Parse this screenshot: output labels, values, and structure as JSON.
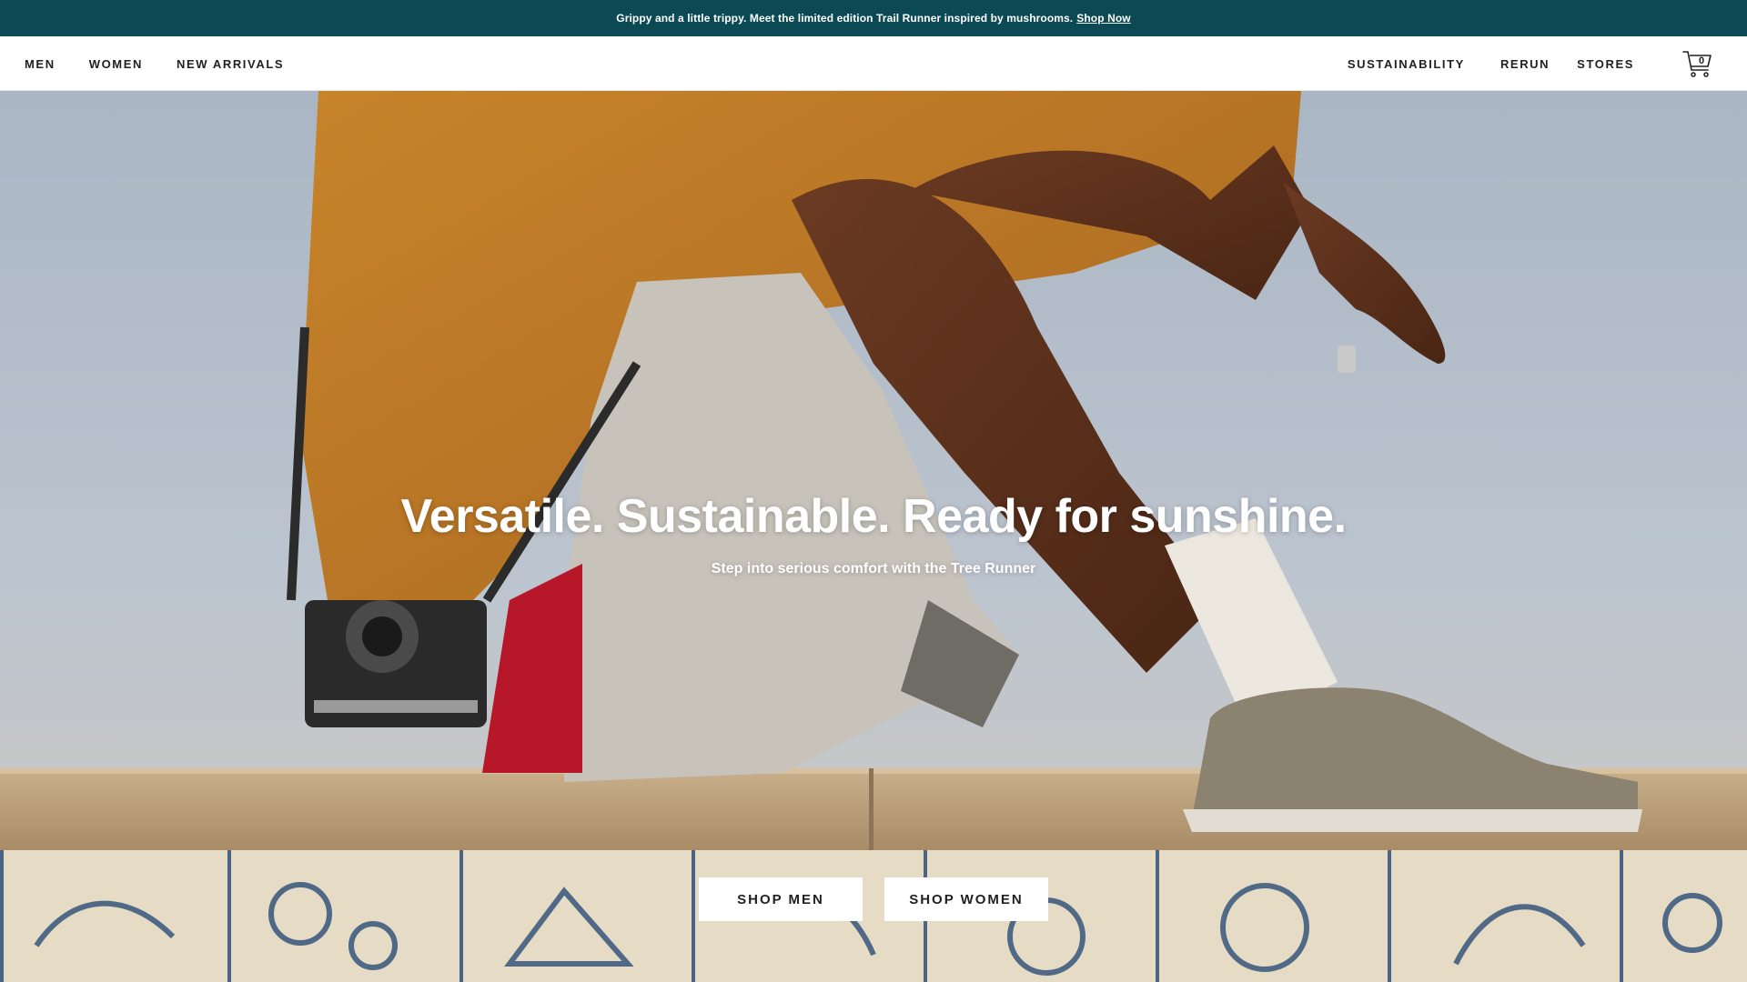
{
  "promo": {
    "message": "Grippy and a little trippy. Meet the limited edition Trail Runner inspired by mushrooms.",
    "link_label": "Shop Now",
    "background": "#0b4a55"
  },
  "nav": {
    "left_items": [
      {
        "label": "MEN"
      },
      {
        "label": "WOMEN"
      },
      {
        "label": "NEW ARRIVALS"
      }
    ],
    "right_items": [
      {
        "label": "SUSTAINABILITY"
      },
      {
        "label": "RERUN"
      },
      {
        "label": "STORES"
      }
    ],
    "cart": {
      "icon": "cart-icon",
      "count": "0"
    }
  },
  "hero": {
    "title": "Versatile. Sustainable. Ready for sunshine.",
    "subtitle": "Step into serious comfort with the Tree Runner",
    "buttons": [
      {
        "label": "SHOP MEN"
      },
      {
        "label": "SHOP WOMEN"
      }
    ]
  }
}
